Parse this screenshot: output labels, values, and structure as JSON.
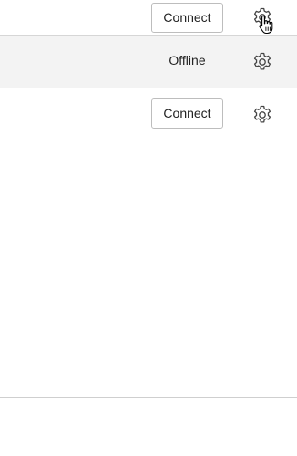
{
  "devices": [
    {
      "action_label": "Connect",
      "status": "",
      "settings_icon": "gear-icon"
    },
    {
      "action_label": "",
      "status": "Offline",
      "settings_icon": "gear-icon"
    },
    {
      "action_label": "Connect",
      "status": "",
      "settings_icon": "gear-icon"
    }
  ],
  "colors": {
    "row_highlight": "#f3f3f3",
    "divider": "#d6d6d6",
    "button_border": "#bdbdbd",
    "icon": "#444444"
  }
}
